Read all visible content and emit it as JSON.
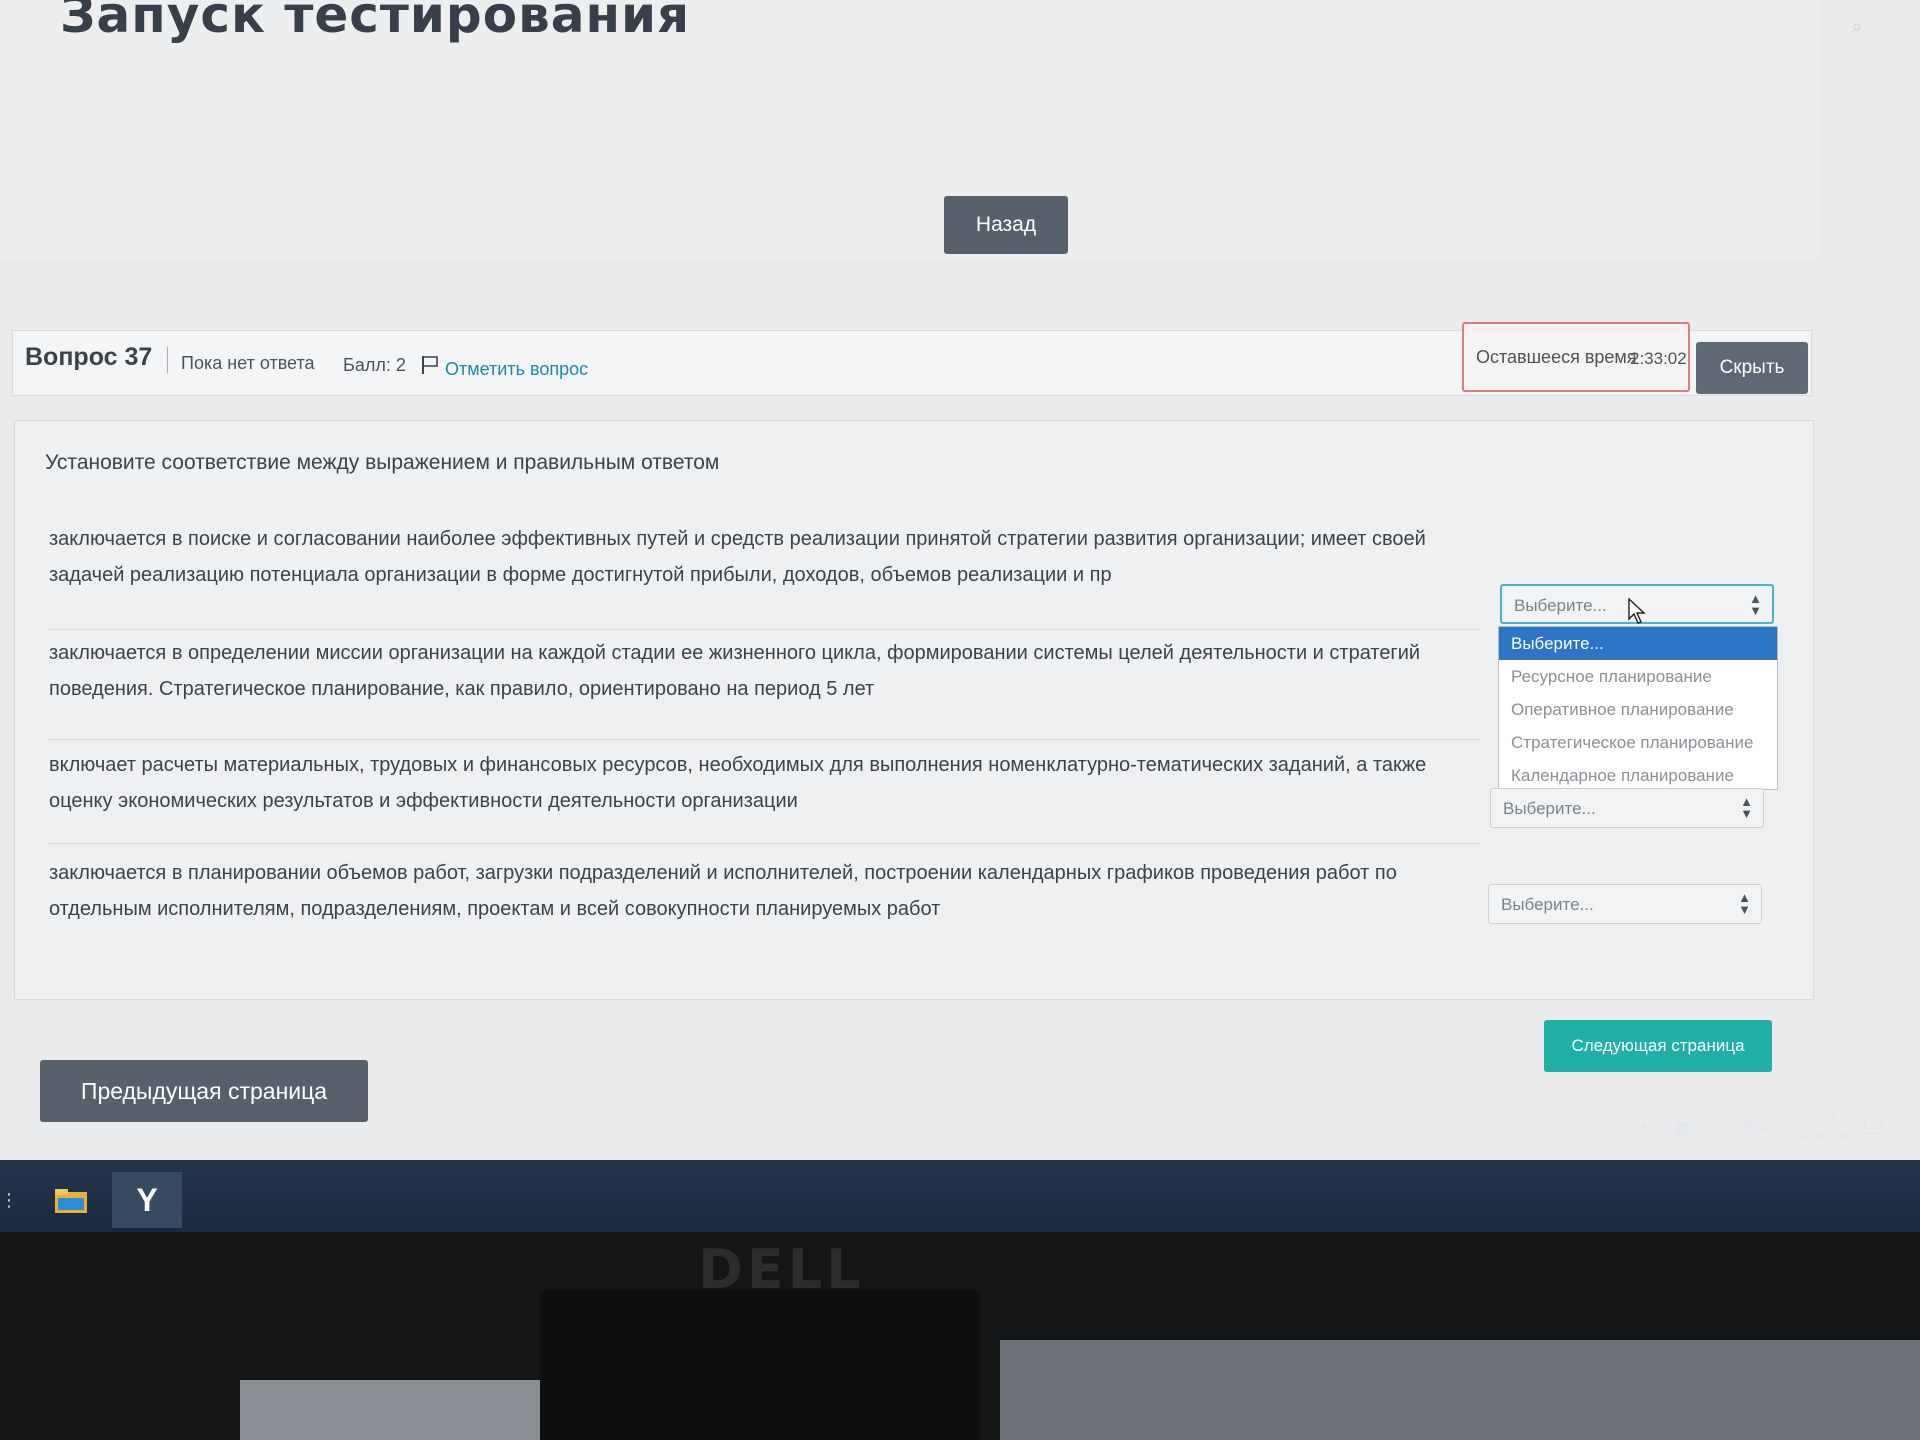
{
  "header": {
    "title": "Запуск тестирования",
    "back_label": "Назад"
  },
  "question": {
    "number": "Вопрос 37",
    "status": "Пока нет ответа",
    "score": "Балл: 2",
    "flag_label": "Отметить вопрос",
    "prompt": "Установите соответствие между выражением и правильным ответом",
    "rows": [
      {
        "text": "заключается в поиске и согласовании наиболее эффективных путей и средств реализации принятой стратегии развития организации; имеет своей задачей реализацию потенциала организации в форме достигнутой прибыли, доходов, объемов реализации и пр",
        "select": "Выберите..."
      },
      {
        "text": "заключается в определении миссии организации на каждой стадии ее жизненного цикла, формировании системы целей деятельности и стратегий поведения. Стратегическое планирование, как правило, ориентировано на период 5 лет",
        "select": "Выберите..."
      },
      {
        "text": "включает расчеты материальных, трудовых и финансовых ресурсов, необходимых для выполнения номенклатурно-тематических заданий, а также оценку экономических результатов и эффективности деятельности организации",
        "select": "Выберите..."
      },
      {
        "text": "заключается в планировании объемов работ, загрузки подразделений и исполнителей, построении календарных графиков проведения работ по отдельным исполнителям, подразделениям, проектам и всей совокупности планируемых работ",
        "select": "Выберите..."
      }
    ],
    "dropdown_options": [
      "Выберите...",
      "Ресурсное планирование",
      "Оперативное планирование",
      "Стратегическое планирование",
      "Календарное планирование"
    ]
  },
  "timer": {
    "label": "Оставшееся время",
    "value": "2:33:02",
    "hide_label": "Скрыть"
  },
  "navigation": {
    "prev_label": "Предыдущая страница",
    "next_label": "Следующая страница"
  },
  "tray": {
    "lang": "РУС",
    "time": "10:34",
    "date": "26.08.2026"
  },
  "taskbar": {
    "browser_glyph": "Y"
  },
  "monitor": {
    "brand": "DELL"
  },
  "colors": {
    "accent": "#20b0a6",
    "link": "#1a8aa6",
    "selected_option": "#2d74c6",
    "timer_border": "#d97e7e"
  }
}
